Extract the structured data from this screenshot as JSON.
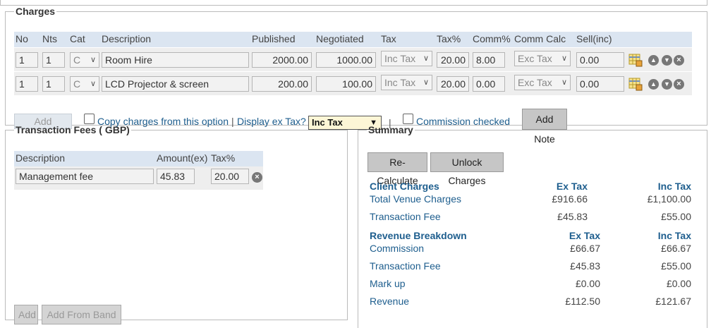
{
  "charges": {
    "legend": "Charges",
    "columns": [
      "No",
      "Nts",
      "Cat",
      "Description",
      "Published",
      "Negotiated",
      "Tax",
      "Tax%",
      "Comm%",
      "Comm Calc",
      "Sell(inc)"
    ],
    "rows": [
      {
        "no": "1",
        "nts": "1",
        "cat": "C",
        "description": "Room Hire",
        "published": "2000.00",
        "negotiated": "1000.00",
        "tax": "Inc Tax",
        "tax_pct": "20.00",
        "comm_pct": "8.00",
        "comm_calc": "Exc Tax",
        "sell_inc": "0.00"
      },
      {
        "no": "1",
        "nts": "1",
        "cat": "C",
        "description": "LCD Projector & screen",
        "published": "200.00",
        "negotiated": "100.00",
        "tax": "Inc Tax",
        "tax_pct": "20.00",
        "comm_pct": "0.00",
        "comm_calc": "Exc Tax",
        "sell_inc": "0.00"
      }
    ],
    "add_label": "Add",
    "copy_label": "Copy charges from this option",
    "separator": "|",
    "display_label": "Display ex Tax?",
    "display_value": "Inc Tax",
    "commission_label": "Commission checked",
    "add_note_label": "Add Note"
  },
  "fees": {
    "legend": "Transaction Fees ( GBP)",
    "columns": [
      "Description",
      "Amount(ex)",
      "Tax%"
    ],
    "rows": [
      {
        "description": "Management fee",
        "amount": "45.83",
        "tax_pct": "20.00"
      }
    ],
    "add_label": "Add",
    "add_band_label": "Add From Band"
  },
  "summary": {
    "legend": "Summary",
    "recalc_label": "Re-Calculate",
    "unlock_label": "Unlock Charges",
    "client_charges": {
      "title": "Client Charges",
      "ex_head": "Ex Tax",
      "inc_head": "Inc Tax",
      "rows": [
        {
          "label": "Total Venue Charges",
          "ex": "£916.66",
          "inc": "£1,100.00"
        },
        {
          "label": "Transaction Fee",
          "ex": "£45.83",
          "inc": "£55.00"
        }
      ]
    },
    "revenue": {
      "title": "Revenue Breakdown",
      "ex_head": "Ex Tax",
      "inc_head": "Inc Tax",
      "rows": [
        {
          "label": "Commission",
          "ex": "£66.67",
          "inc": "£66.67"
        },
        {
          "label": "Transaction Fee",
          "ex": "£45.83",
          "inc": "£55.00"
        },
        {
          "label": "Mark up",
          "ex": "£0.00",
          "inc": "£0.00"
        },
        {
          "label": "Revenue",
          "ex": "£112.50",
          "inc": "£121.67"
        }
      ]
    }
  },
  "icons": {
    "edit": "edit-table-icon",
    "up": "move-up-icon",
    "down": "move-down-icon",
    "delete": "delete-icon"
  },
  "colors": {
    "header_bg": "#dbe5f1",
    "row_bg": "#eeeeee",
    "link": "#1e5e8e",
    "select_highlight": "#fdf6d6"
  }
}
